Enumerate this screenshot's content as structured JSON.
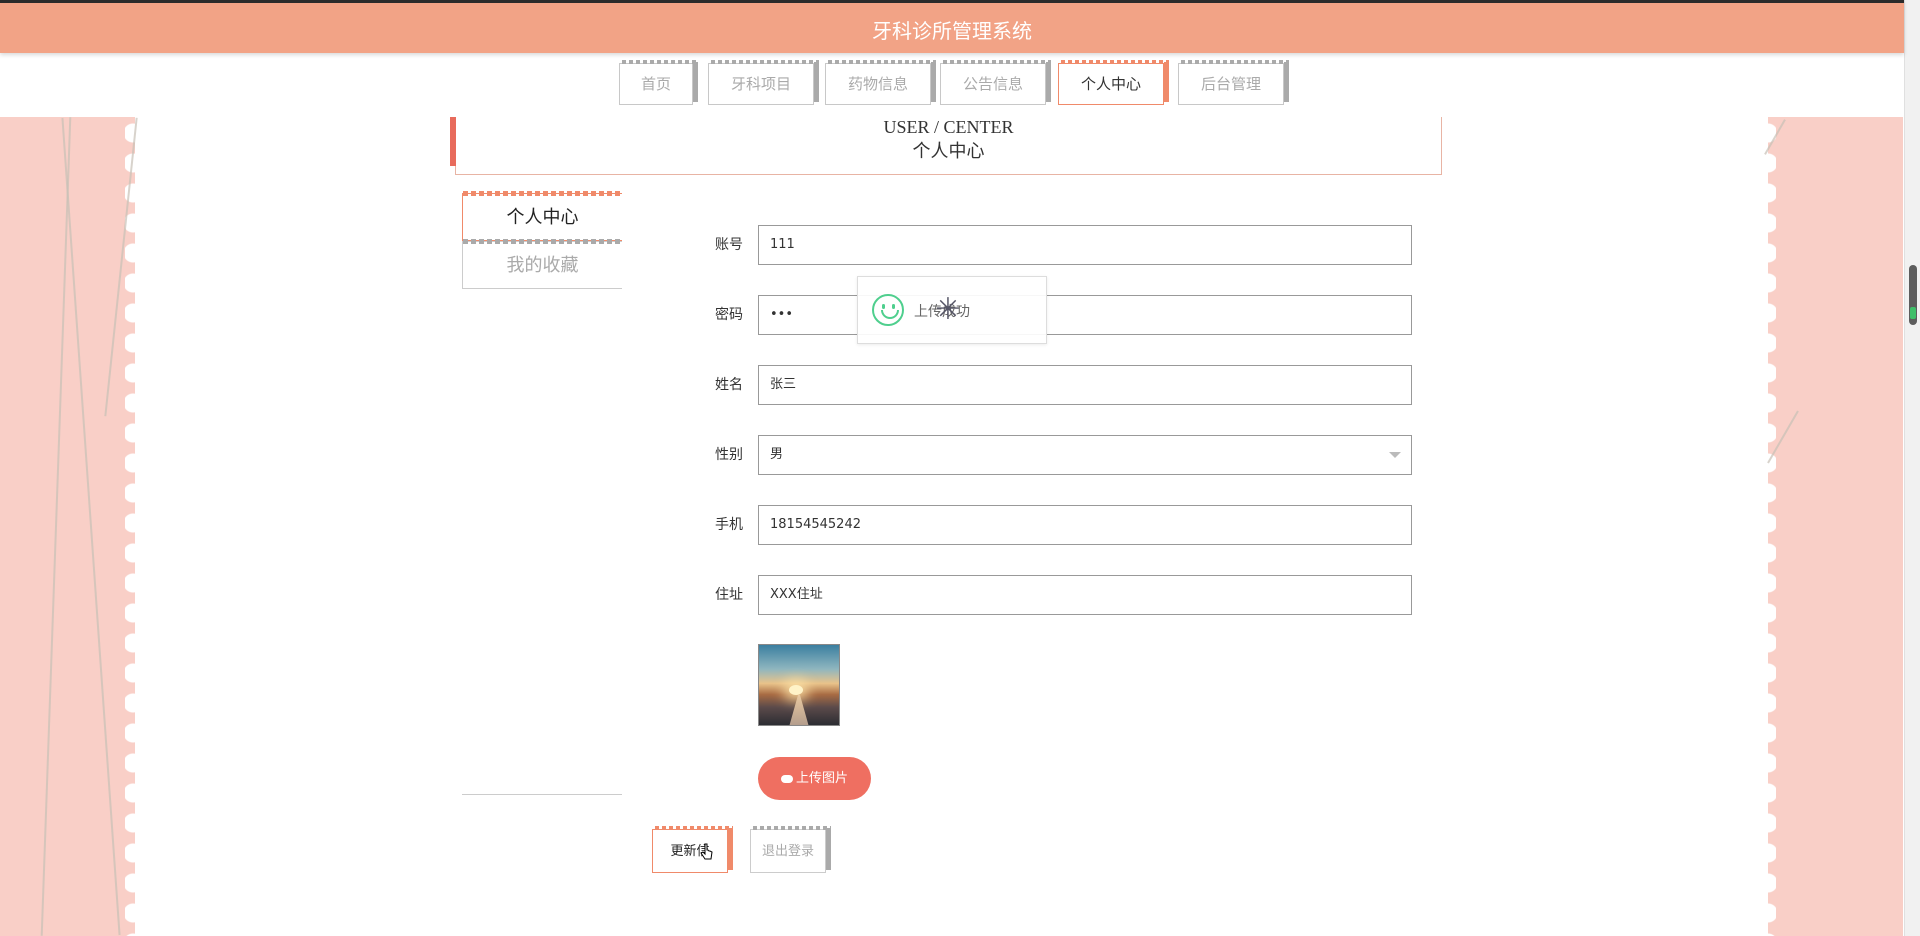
{
  "header": {
    "title": "牙科诊所管理系统"
  },
  "nav": {
    "items": [
      {
        "label": "首页"
      },
      {
        "label": "牙科项目"
      },
      {
        "label": "药物信息"
      },
      {
        "label": "公告信息"
      },
      {
        "label": "个人中心"
      },
      {
        "label": "后台管理"
      }
    ],
    "active": "个人中心"
  },
  "page_heading": {
    "en": "USER / CENTER",
    "cn": "个人中心"
  },
  "side_menu": {
    "items": [
      {
        "label": "个人中心"
      },
      {
        "label": "我的收藏"
      }
    ]
  },
  "form": {
    "account": {
      "label": "账号",
      "value": "111"
    },
    "password": {
      "label": "密码",
      "value": "•••"
    },
    "name": {
      "label": "姓名",
      "value": "张三"
    },
    "gender": {
      "label": "性别",
      "value": "男"
    },
    "phone": {
      "label": "手机",
      "value": "18154545242"
    },
    "address": {
      "label": "住址",
      "value": "XXX住址"
    }
  },
  "upload_button": {
    "label": "上传图片",
    "icon": "cloud-upload-icon"
  },
  "actions": {
    "update_label": "更新信",
    "logout_label": "退出登录"
  },
  "toast": {
    "message": "上传成功",
    "icon": "smile-icon"
  },
  "colors": {
    "header_bg": "#f2a386",
    "accent": "#ef6f61",
    "side_panel": "#f9cfc7",
    "success": "#4fcf8e"
  }
}
